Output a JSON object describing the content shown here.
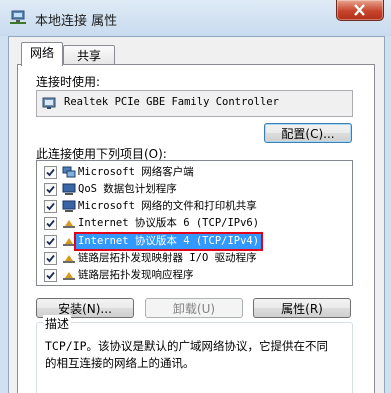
{
  "window": {
    "title": "本地连接 属性"
  },
  "tabs": [
    {
      "label": "网络",
      "active": true
    },
    {
      "label": "共享",
      "active": false
    }
  ],
  "connect_using": {
    "label": "连接时使用:",
    "adapter": "Realtek PCIe GBE Family Controller",
    "configure_button": "配置(C)..."
  },
  "items_section": {
    "label": "此连接使用下列项目(O):",
    "items": [
      {
        "label": "Microsoft 网络客户端",
        "checked": true,
        "icon": "network-client-icon"
      },
      {
        "label": "QoS 数据包计划程序",
        "checked": true,
        "icon": "network-service-icon"
      },
      {
        "label": "Microsoft 网络的文件和打印机共享",
        "checked": true,
        "icon": "network-service-icon"
      },
      {
        "label": "Internet 协议版本 6 (TCP/IPv6)",
        "checked": true,
        "icon": "protocol-icon"
      },
      {
        "label": "Internet 协议版本 4 (TCP/IPv4)",
        "checked": true,
        "icon": "protocol-icon",
        "selected": true
      },
      {
        "label": "链路层拓扑发现映射器 I/O 驱动程序",
        "checked": true,
        "icon": "protocol-icon"
      },
      {
        "label": "链路层拓扑发现响应程序",
        "checked": true,
        "icon": "protocol-icon"
      }
    ]
  },
  "buttons": {
    "install": "安装(N)...",
    "uninstall": "卸载(U)",
    "properties": "属性(R)"
  },
  "description": {
    "legend": "描述",
    "line1": "TCP/IP。该协议是默认的广域网络协议，它提供在不同",
    "line2": "的相互连接的网络上的通讯。"
  },
  "colors": {
    "selection": "#3399ff",
    "highlight_box": "#e3001b",
    "close_button": "#c7452c"
  }
}
